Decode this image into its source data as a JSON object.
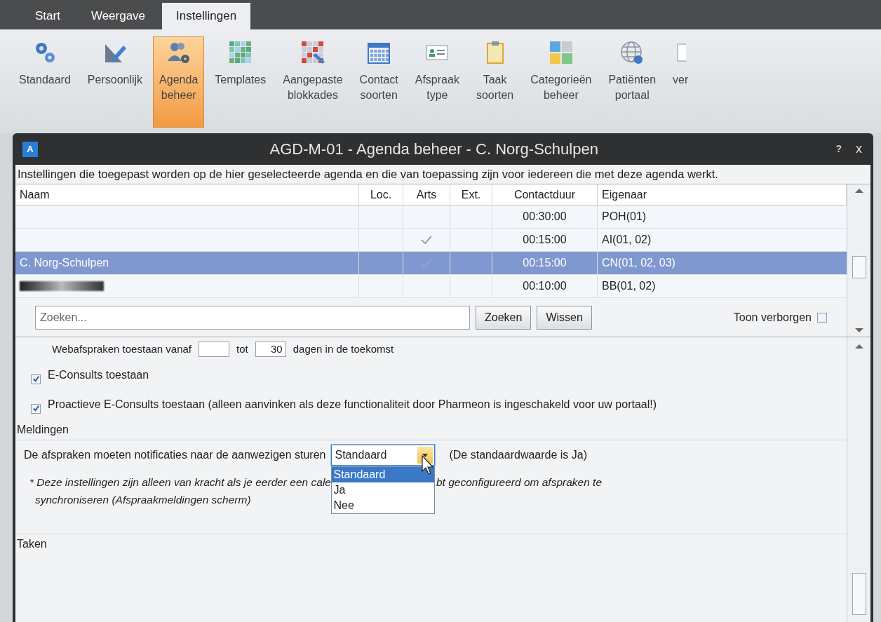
{
  "tabs": [
    {
      "label": "Start",
      "selected": false
    },
    {
      "label": "Weergave",
      "selected": false
    },
    {
      "label": "Instellingen",
      "selected": true
    }
  ],
  "ribbon": [
    {
      "lines": [
        "Standaard"
      ],
      "selected": false
    },
    {
      "lines": [
        "Persoonlijk"
      ],
      "selected": false
    },
    {
      "lines": [
        "Agenda",
        "beheer"
      ],
      "selected": true
    },
    {
      "lines": [
        "Templates"
      ],
      "selected": false
    },
    {
      "lines": [
        "Aangepaste",
        "blokkades"
      ],
      "selected": false
    },
    {
      "lines": [
        "Contact",
        "soorten"
      ],
      "selected": false
    },
    {
      "lines": [
        "Afspraak",
        "type"
      ],
      "selected": false
    },
    {
      "lines": [
        "Taak",
        "soorten"
      ],
      "selected": false
    },
    {
      "lines": [
        "Categorieën",
        "beheer"
      ],
      "selected": false
    },
    {
      "lines": [
        "Patiënten",
        "portaal"
      ],
      "selected": false
    },
    {
      "lines": [
        "ver"
      ],
      "selected": false
    }
  ],
  "dialog": {
    "logo": "A",
    "title": "AGD-M-01 - Agenda beheer - C. Norg-Schulpen",
    "help": "?",
    "close": "x",
    "description": "Instellingen die toegepast worden op de hier geselecteerde agenda en die van toepassing zijn voor iedereen die met deze agenda werkt.",
    "table": {
      "columns": [
        "Naam",
        "Loc.",
        "Arts",
        "Ext.",
        "Contactduur",
        "Eigenaar"
      ],
      "rows": [
        {
          "naam": "",
          "name_hidden": false,
          "arts": false,
          "contactduur": "00:30:00",
          "eigenaar": "POH(01)",
          "selected": false
        },
        {
          "naam": "",
          "name_hidden": false,
          "arts": true,
          "contactduur": "00:15:00",
          "eigenaar": "AI(01, 02)",
          "selected": false
        },
        {
          "naam": "C. Norg-Schulpen",
          "name_hidden": false,
          "arts": true,
          "contactduur": "00:15:00",
          "eigenaar": "CN(01, 02, 03)",
          "selected": true
        },
        {
          "naam": "",
          "name_hidden": true,
          "arts": false,
          "contactduur": "00:10:00",
          "eigenaar": "BB(01, 02)",
          "selected": false
        }
      ]
    },
    "search": {
      "placeholder": "Zoeken...",
      "buttons": [
        "Zoeken",
        "Wissen"
      ],
      "show_hidden": {
        "label": "Toon verborgen",
        "checked": false
      }
    },
    "settings": {
      "web": {
        "before": "Webafspraken toestaan vanaf",
        "middle": "tot",
        "to": "30",
        "after": "dagen in de toekomst"
      },
      "checkboxes": [
        {
          "label": "E-Consults toestaan",
          "checked": true
        },
        {
          "label": "Proactieve E-Consults toestaan (alleen aanvinken als deze functionaliteit door Pharmeon is ingeschakeld voor uw portaal!)",
          "checked": true
        }
      ],
      "meldingen": {
        "title": "Meldingen",
        "label": "De afspraken moeten notificaties naar de aanwezigen sturen",
        "value": "Standaard",
        "expanded": true,
        "options": [
          {
            "label": "Standaard",
            "selected": true
          },
          {
            "label": "Ja",
            "selected": false
          },
          {
            "label": "Nee",
            "selected": false
          }
        ],
        "note": "(De standaardwaarde is Ja)",
        "footnote_start": "* Deze instellingen zijn alleen van kracht als je eerder een cale",
        "footnote_end": "bt geconfigureerd om afspraken te",
        "footnote_line2": "synchroniseren (Afspraakmeldingen scherm)"
      },
      "taken": {
        "title": "Taken"
      }
    }
  }
}
